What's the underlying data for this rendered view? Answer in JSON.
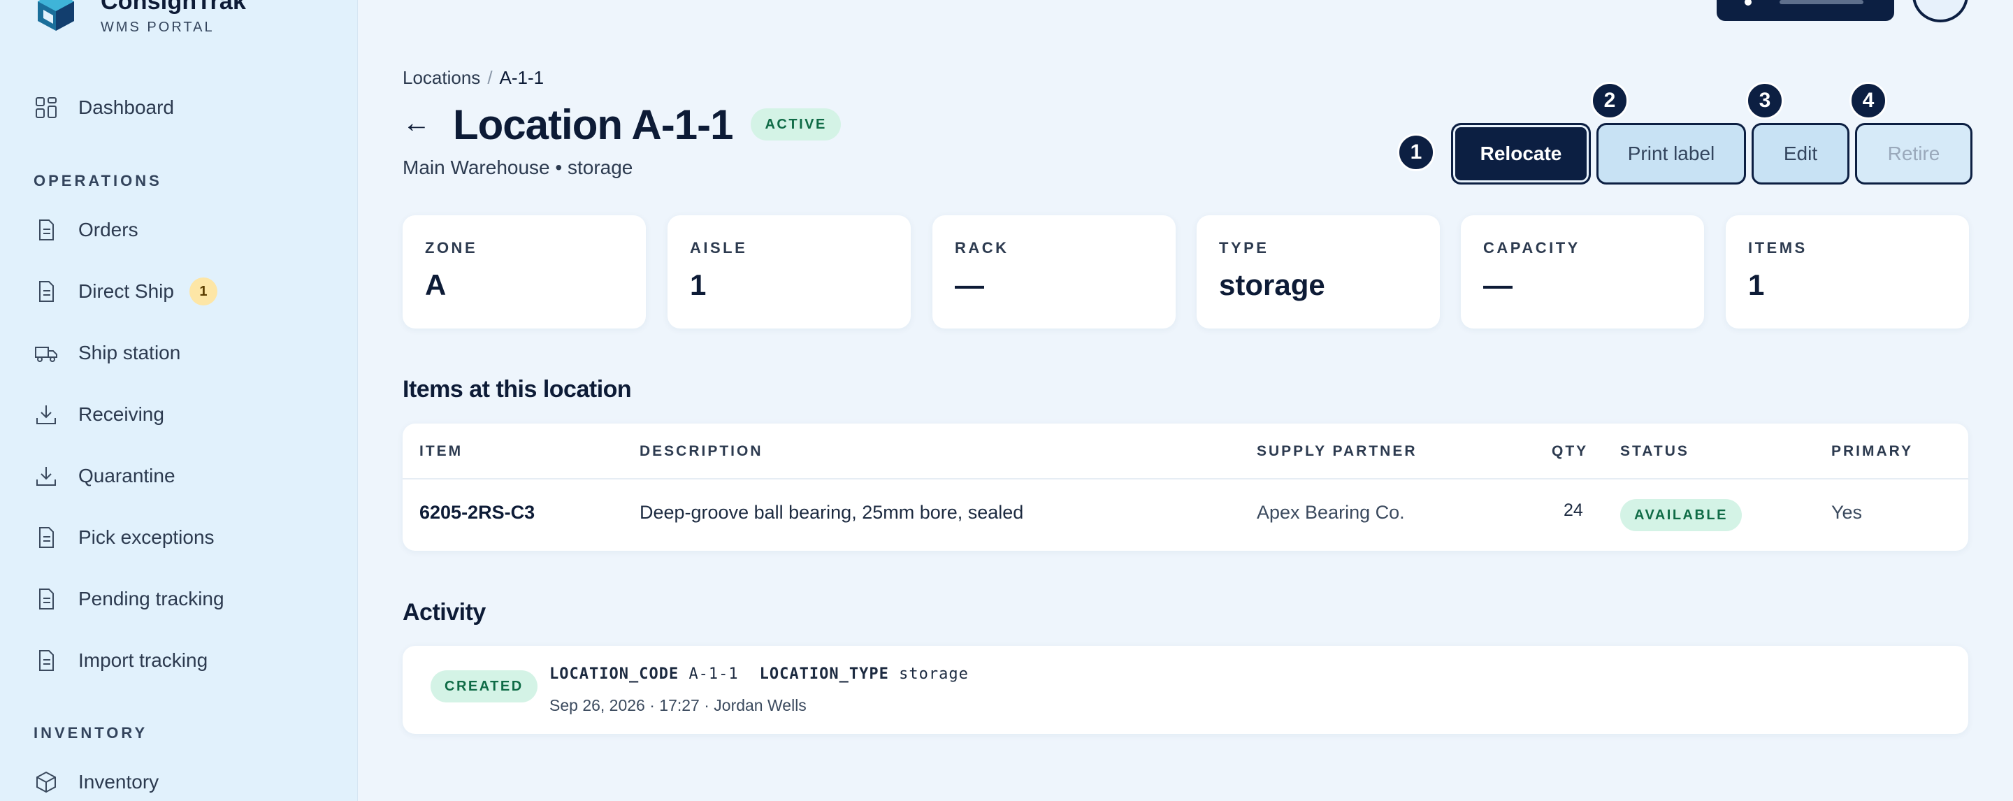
{
  "brand": {
    "name": "ConsignTrak",
    "subtitle": "WMS PORTAL"
  },
  "sidebar": {
    "dashboard": "Dashboard",
    "operations_heading": "OPERATIONS",
    "operations": [
      {
        "label": "Orders",
        "icon": "document-icon"
      },
      {
        "label": "Direct Ship",
        "icon": "document-icon",
        "badge": "1"
      },
      {
        "label": "Ship station",
        "icon": "truck-icon"
      },
      {
        "label": "Receiving",
        "icon": "download-tray-icon"
      },
      {
        "label": "Quarantine",
        "icon": "download-tray-icon"
      },
      {
        "label": "Pick exceptions",
        "icon": "document-icon"
      },
      {
        "label": "Pending tracking",
        "icon": "document-icon"
      },
      {
        "label": "Import tracking",
        "icon": "document-icon"
      }
    ],
    "inventory_heading": "INVENTORY",
    "inventory": [
      {
        "label": "Inventory",
        "icon": "box-icon"
      }
    ]
  },
  "breadcrumb": {
    "parent": "Locations",
    "separator": "/",
    "current": "A-1-1"
  },
  "header": {
    "back": "←",
    "title": "Location A-1-1",
    "status": "ACTIVE",
    "subtitle": "Main Warehouse • storage"
  },
  "actions": {
    "relocate": "Relocate",
    "print_label": "Print label",
    "edit": "Edit",
    "retire": "Retire"
  },
  "markers": [
    "1",
    "2",
    "3",
    "4"
  ],
  "stats": [
    {
      "label": "ZONE",
      "value": "A"
    },
    {
      "label": "AISLE",
      "value": "1"
    },
    {
      "label": "RACK",
      "value": "—"
    },
    {
      "label": "TYPE",
      "value": "storage"
    },
    {
      "label": "CAPACITY",
      "value": "—"
    },
    {
      "label": "ITEMS",
      "value": "1"
    }
  ],
  "items_section": {
    "title": "Items at this location",
    "columns": [
      "ITEM",
      "DESCRIPTION",
      "SUPPLY PARTNER",
      "QTY",
      "STATUS",
      "PRIMARY"
    ],
    "rows": [
      {
        "item": "6205-2RS-C3",
        "description": "Deep-groove ball bearing, 25mm bore, sealed",
        "supply_partner": "Apex Bearing Co.",
        "qty": "24",
        "status": "AVAILABLE",
        "primary": "Yes"
      }
    ]
  },
  "activity": {
    "title": "Activity",
    "entries": [
      {
        "badge": "CREATED",
        "field1_key": "LOCATION_CODE",
        "field1_value": "A-1-1",
        "field2_key": "LOCATION_TYPE",
        "field2_value": "storage",
        "meta": "Sep 26, 2026 · 17:27 · Jordan Wells"
      }
    ]
  },
  "colors": {
    "navy": "#0c1f42",
    "sidebar_bg": "#e1f1fc",
    "page_bg": "#eef5fc",
    "success_bg": "#d4f3e6",
    "success_text": "#0f6b46",
    "badge_bg": "#fde6a6"
  }
}
